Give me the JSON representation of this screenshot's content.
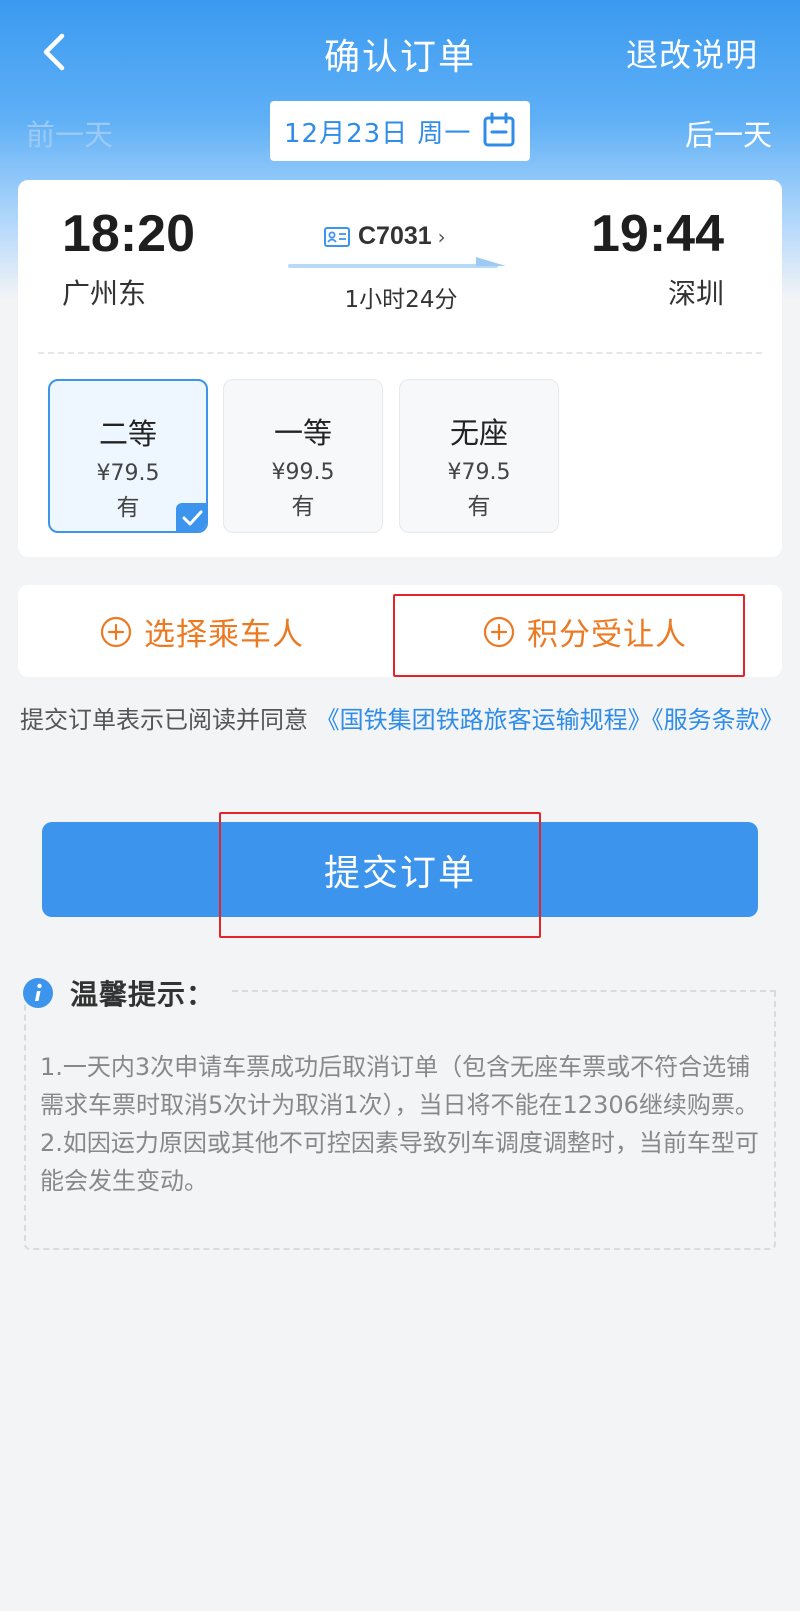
{
  "nav": {
    "title": "确认订单",
    "right_label": "退改说明"
  },
  "date_bar": {
    "prev_label": "前一天",
    "date": "12月23日 周一",
    "next_label": "后一天"
  },
  "train": {
    "depart_time": "18:20",
    "depart_station": "广州东",
    "arrive_time": "19:44",
    "arrive_station": "深圳",
    "train_no": "C7031",
    "duration": "1小时24分"
  },
  "seats": [
    {
      "name": "二等",
      "price": "¥79.5",
      "availability": "有",
      "selected": true
    },
    {
      "name": "一等",
      "price": "¥99.5",
      "availability": "有",
      "selected": false
    },
    {
      "name": "无座",
      "price": "¥79.5",
      "availability": "有",
      "selected": false
    }
  ],
  "passenger_actions": {
    "select_passenger": "选择乘车人",
    "points_beneficiary": "积分受让人"
  },
  "agreement": {
    "prefix": "提交订单表示已阅读并同意",
    "rules_link": "《国铁集团铁路旅客运输规程》",
    "terms_link": "《服务条款》"
  },
  "submit_label": "提交订单",
  "tips": {
    "title": "温馨提示：",
    "line1": "1.一天内3次申请车票成功后取消订单（包含无座车票或不符合选铺需求车票时取消5次计为取消1次），当日将不能在12306继续购票。",
    "line2": "2.如因运力原因或其他不可控因素导致列车调度调整时，当前车型可能会发生变动。"
  },
  "colors": {
    "primary_blue": "#3d94ec",
    "accent_orange": "#ec7a23",
    "highlight_red": "#e5232b"
  }
}
